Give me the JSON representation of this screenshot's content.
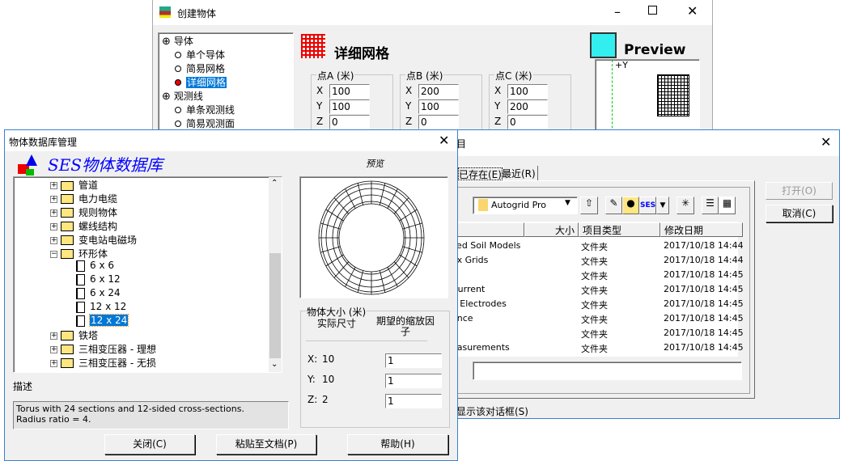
{
  "create_window": {
    "title": "创建物体",
    "tree": [
      {
        "label": "导体",
        "type": "group"
      },
      {
        "label": "单个导体",
        "type": "item"
      },
      {
        "label": "简易网格",
        "type": "item"
      },
      {
        "label": "详细网格",
        "type": "item",
        "selected": true
      },
      {
        "label": "观测线",
        "type": "group"
      },
      {
        "label": "单条观测线",
        "type": "item"
      },
      {
        "label": "简易观测面",
        "type": "item"
      }
    ],
    "panel_title": "详细网格",
    "preview_label": "Preview",
    "axis_label": "+Y",
    "points": [
      {
        "label": "点A (米)",
        "x": "100",
        "y": "100",
        "z": "0"
      },
      {
        "label": "点B (米)",
        "x": "200",
        "y": "100",
        "z": "0"
      },
      {
        "label": "点C (米)",
        "x": "100",
        "y": "200",
        "z": "0"
      }
    ],
    "axis_names": {
      "x": "X",
      "y": "Y",
      "z": "Z"
    }
  },
  "file_dialog": {
    "title_fragment": "目",
    "tabs": [
      "已存在(E)",
      "最近(R)"
    ],
    "folder": "Autogrid Pro",
    "toolbar_ses": "SES",
    "columns": [
      "大小",
      "项目类型",
      "修改日期"
    ],
    "rows": [
      {
        "name": "ced Soil Models",
        "type": "文件夹",
        "date": "2017/10/18 14:44"
      },
      {
        "name": "ex Grids",
        "type": "文件夹",
        "date": "2017/10/18 14:44"
      },
      {
        "name": "1",
        "type": "文件夹",
        "date": "2017/10/18 14:45"
      },
      {
        "name": "Current",
        "type": "文件夹",
        "date": "2017/10/18 14:45"
      },
      {
        "name": "e Electrodes",
        "type": "文件夹",
        "date": "2017/10/18 14:45"
      },
      {
        "name": "ance",
        "type": "文件夹",
        "date": "2017/10/18 14:45"
      },
      {
        "name": "",
        "type": "文件夹",
        "date": "2017/10/18 14:45"
      },
      {
        "name": "easurements",
        "type": "文件夹",
        "date": "2017/10/18 14:45"
      }
    ],
    "open_label": "打开(O)",
    "cancel_label": "取消(C)",
    "show_dialog_label": "显示该对话框(S)"
  },
  "db_window": {
    "title": "物体数据库管理",
    "banner": "SES物体数据库",
    "preview_label": "预览",
    "tree": [
      {
        "label": "管道",
        "type": "folder"
      },
      {
        "label": "电力电缆",
        "type": "folder"
      },
      {
        "label": "规则物体",
        "type": "folder"
      },
      {
        "label": "螺线结构",
        "type": "folder"
      },
      {
        "label": "变电站电磁场",
        "type": "folder"
      },
      {
        "label": "环形体",
        "type": "open-folder"
      },
      {
        "label": "6 x 6",
        "type": "doc"
      },
      {
        "label": "6 x 12",
        "type": "doc"
      },
      {
        "label": "6 x 24",
        "type": "doc"
      },
      {
        "label": "12 x 12",
        "type": "doc"
      },
      {
        "label": "12 x 24",
        "type": "doc",
        "selected": true
      },
      {
        "label": "铁塔",
        "type": "folder"
      },
      {
        "label": "三相变压器 - 理想",
        "type": "folder"
      },
      {
        "label": "三相变压器 - 无损",
        "type": "folder"
      }
    ],
    "size_group": {
      "label": "物体大小 (米)",
      "col1": "实际尺寸",
      "col2": "期望的缩放因子",
      "rows": [
        {
          "axis": "X:",
          "value": "10",
          "scale": "1"
        },
        {
          "axis": "Y:",
          "value": "10",
          "scale": "1"
        },
        {
          "axis": "Z:",
          "value": "2",
          "scale": "1"
        }
      ]
    },
    "description_label": "描述",
    "description": "Torus with 24 sections and 12-sided cross-sections.\nRadius ratio = 4.",
    "buttons": {
      "close": "关闭(C)",
      "paste": "粘贴至文档(P)",
      "help": "帮助(H)"
    }
  },
  "colors": {
    "selection": "#0078d7",
    "banner": "#0000ff",
    "face": "#f0f0f0"
  }
}
